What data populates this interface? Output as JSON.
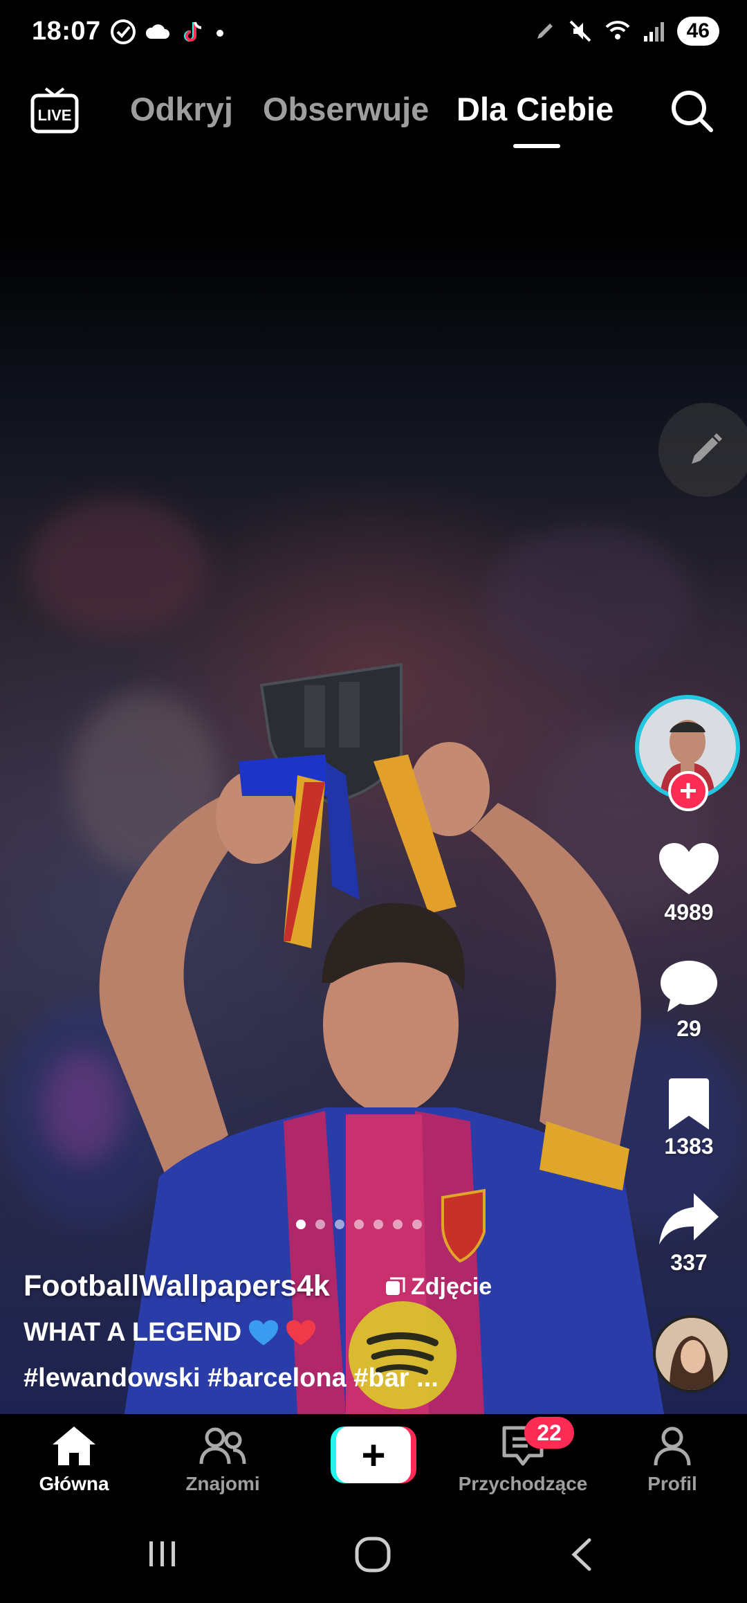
{
  "status_bar": {
    "time": "18:07",
    "battery": "46"
  },
  "top_nav": {
    "live_label": "LIVE",
    "tabs": [
      {
        "label": "Odkryj",
        "active": false
      },
      {
        "label": "Obserwuje",
        "active": false
      },
      {
        "label": "Dla Ciebie",
        "active": true
      }
    ]
  },
  "actions": {
    "likes": "4989",
    "comments": "29",
    "saves": "1383",
    "shares": "337"
  },
  "post": {
    "carousel_pages": 7,
    "carousel_active_page": 1,
    "username": "FootballWallpapers4k",
    "type_label": "Zdjęcie",
    "caption": "WHAT A LEGEND",
    "caption_emoji": [
      "blue-heart",
      "red-heart"
    ],
    "hashtags": "#lewandowski #barcelona #bar ..."
  },
  "bottom_nav": {
    "items": [
      {
        "label": "Główna",
        "active": true
      },
      {
        "label": "Znajomi",
        "active": false
      },
      {
        "label": "Przychodzące",
        "active": false,
        "badge": "22"
      },
      {
        "label": "Profil",
        "active": false
      }
    ]
  },
  "colors": {
    "accent_red": "#fe2c55",
    "accent_cyan": "#25f4ee",
    "avatar_ring": "#25c6e0"
  }
}
